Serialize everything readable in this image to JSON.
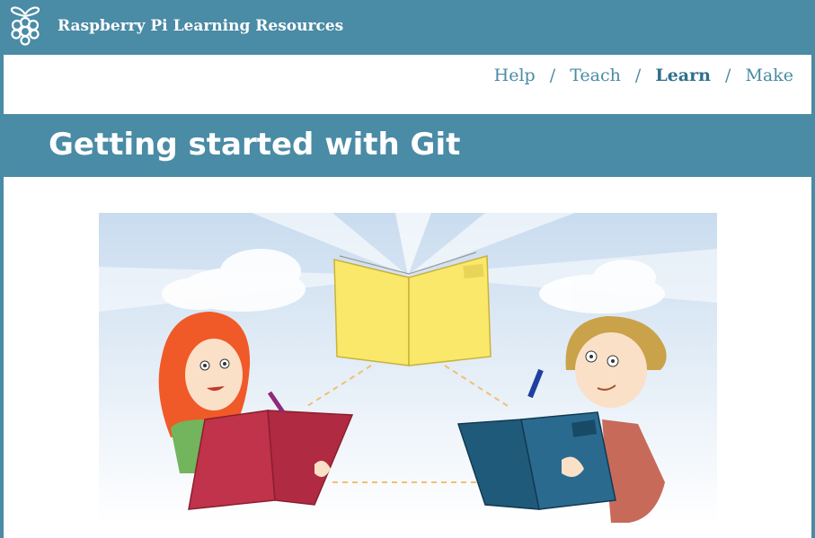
{
  "header": {
    "site_title": "Raspberry Pi Learning Resources",
    "logo_icon": "raspberry-logo-icon"
  },
  "nav": {
    "items": [
      {
        "label": "Help",
        "active": false
      },
      {
        "label": "Teach",
        "active": false
      },
      {
        "label": "Learn",
        "active": true
      },
      {
        "label": "Make",
        "active": false
      }
    ],
    "separator": "/"
  },
  "page": {
    "title": "Getting started with Git"
  },
  "hero": {
    "icon": "collaboration-illustration"
  },
  "colors": {
    "brand": "#4a8ba6",
    "background": "#ffffff"
  }
}
